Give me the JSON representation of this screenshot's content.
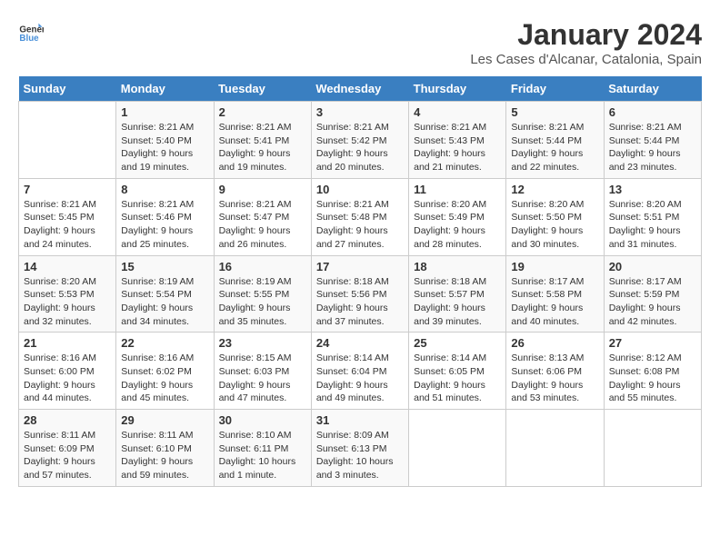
{
  "header": {
    "logo_line1": "General",
    "logo_line2": "Blue",
    "main_title": "January 2024",
    "subtitle": "Les Cases d'Alcanar, Catalonia, Spain"
  },
  "days_of_week": [
    "Sunday",
    "Monday",
    "Tuesday",
    "Wednesday",
    "Thursday",
    "Friday",
    "Saturday"
  ],
  "weeks": [
    [
      {
        "day": "",
        "info": ""
      },
      {
        "day": "1",
        "info": "Sunrise: 8:21 AM\nSunset: 5:40 PM\nDaylight: 9 hours\nand 19 minutes."
      },
      {
        "day": "2",
        "info": "Sunrise: 8:21 AM\nSunset: 5:41 PM\nDaylight: 9 hours\nand 19 minutes."
      },
      {
        "day": "3",
        "info": "Sunrise: 8:21 AM\nSunset: 5:42 PM\nDaylight: 9 hours\nand 20 minutes."
      },
      {
        "day": "4",
        "info": "Sunrise: 8:21 AM\nSunset: 5:43 PM\nDaylight: 9 hours\nand 21 minutes."
      },
      {
        "day": "5",
        "info": "Sunrise: 8:21 AM\nSunset: 5:44 PM\nDaylight: 9 hours\nand 22 minutes."
      },
      {
        "day": "6",
        "info": "Sunrise: 8:21 AM\nSunset: 5:44 PM\nDaylight: 9 hours\nand 23 minutes."
      }
    ],
    [
      {
        "day": "7",
        "info": "Sunrise: 8:21 AM\nSunset: 5:45 PM\nDaylight: 9 hours\nand 24 minutes."
      },
      {
        "day": "8",
        "info": "Sunrise: 8:21 AM\nSunset: 5:46 PM\nDaylight: 9 hours\nand 25 minutes."
      },
      {
        "day": "9",
        "info": "Sunrise: 8:21 AM\nSunset: 5:47 PM\nDaylight: 9 hours\nand 26 minutes."
      },
      {
        "day": "10",
        "info": "Sunrise: 8:21 AM\nSunset: 5:48 PM\nDaylight: 9 hours\nand 27 minutes."
      },
      {
        "day": "11",
        "info": "Sunrise: 8:20 AM\nSunset: 5:49 PM\nDaylight: 9 hours\nand 28 minutes."
      },
      {
        "day": "12",
        "info": "Sunrise: 8:20 AM\nSunset: 5:50 PM\nDaylight: 9 hours\nand 30 minutes."
      },
      {
        "day": "13",
        "info": "Sunrise: 8:20 AM\nSunset: 5:51 PM\nDaylight: 9 hours\nand 31 minutes."
      }
    ],
    [
      {
        "day": "14",
        "info": "Sunrise: 8:20 AM\nSunset: 5:53 PM\nDaylight: 9 hours\nand 32 minutes."
      },
      {
        "day": "15",
        "info": "Sunrise: 8:19 AM\nSunset: 5:54 PM\nDaylight: 9 hours\nand 34 minutes."
      },
      {
        "day": "16",
        "info": "Sunrise: 8:19 AM\nSunset: 5:55 PM\nDaylight: 9 hours\nand 35 minutes."
      },
      {
        "day": "17",
        "info": "Sunrise: 8:18 AM\nSunset: 5:56 PM\nDaylight: 9 hours\nand 37 minutes."
      },
      {
        "day": "18",
        "info": "Sunrise: 8:18 AM\nSunset: 5:57 PM\nDaylight: 9 hours\nand 39 minutes."
      },
      {
        "day": "19",
        "info": "Sunrise: 8:17 AM\nSunset: 5:58 PM\nDaylight: 9 hours\nand 40 minutes."
      },
      {
        "day": "20",
        "info": "Sunrise: 8:17 AM\nSunset: 5:59 PM\nDaylight: 9 hours\nand 42 minutes."
      }
    ],
    [
      {
        "day": "21",
        "info": "Sunrise: 8:16 AM\nSunset: 6:00 PM\nDaylight: 9 hours\nand 44 minutes."
      },
      {
        "day": "22",
        "info": "Sunrise: 8:16 AM\nSunset: 6:02 PM\nDaylight: 9 hours\nand 45 minutes."
      },
      {
        "day": "23",
        "info": "Sunrise: 8:15 AM\nSunset: 6:03 PM\nDaylight: 9 hours\nand 47 minutes."
      },
      {
        "day": "24",
        "info": "Sunrise: 8:14 AM\nSunset: 6:04 PM\nDaylight: 9 hours\nand 49 minutes."
      },
      {
        "day": "25",
        "info": "Sunrise: 8:14 AM\nSunset: 6:05 PM\nDaylight: 9 hours\nand 51 minutes."
      },
      {
        "day": "26",
        "info": "Sunrise: 8:13 AM\nSunset: 6:06 PM\nDaylight: 9 hours\nand 53 minutes."
      },
      {
        "day": "27",
        "info": "Sunrise: 8:12 AM\nSunset: 6:08 PM\nDaylight: 9 hours\nand 55 minutes."
      }
    ],
    [
      {
        "day": "28",
        "info": "Sunrise: 8:11 AM\nSunset: 6:09 PM\nDaylight: 9 hours\nand 57 minutes."
      },
      {
        "day": "29",
        "info": "Sunrise: 8:11 AM\nSunset: 6:10 PM\nDaylight: 9 hours\nand 59 minutes."
      },
      {
        "day": "30",
        "info": "Sunrise: 8:10 AM\nSunset: 6:11 PM\nDaylight: 10 hours\nand 1 minute."
      },
      {
        "day": "31",
        "info": "Sunrise: 8:09 AM\nSunset: 6:13 PM\nDaylight: 10 hours\nand 3 minutes."
      },
      {
        "day": "",
        "info": ""
      },
      {
        "day": "",
        "info": ""
      },
      {
        "day": "",
        "info": ""
      }
    ]
  ]
}
